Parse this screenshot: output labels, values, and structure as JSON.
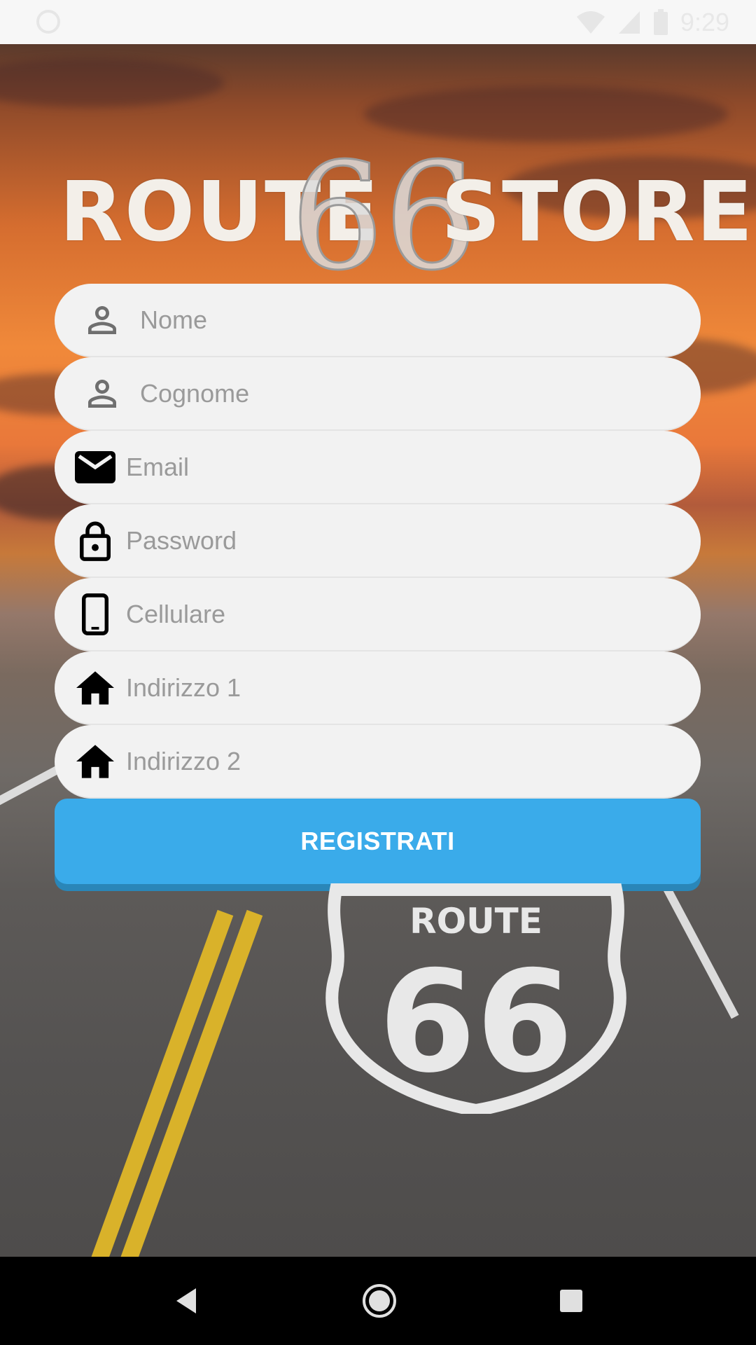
{
  "status_bar": {
    "time": "9:29"
  },
  "logo": {
    "left_word": "ROUTE",
    "number": "66",
    "right_word": "STORE"
  },
  "form": {
    "fields": [
      {
        "placeholder": "Nome",
        "icon": "person-icon"
      },
      {
        "placeholder": "Cognome",
        "icon": "person-icon"
      },
      {
        "placeholder": "Email",
        "icon": "email-icon"
      },
      {
        "placeholder": "Password",
        "icon": "lock-icon"
      },
      {
        "placeholder": "Cellulare",
        "icon": "phone-icon"
      },
      {
        "placeholder": "Indirizzo 1",
        "icon": "home-icon"
      },
      {
        "placeholder": "Indirizzo 2",
        "icon": "home-icon"
      }
    ],
    "submit_label": "REGISTRATI"
  },
  "background": {
    "shield_word": "ROUTE",
    "shield_number": "66"
  },
  "colors": {
    "accent": "#3aabea",
    "field_bg": "#f2f2f2",
    "placeholder": "#9a9a9a"
  }
}
